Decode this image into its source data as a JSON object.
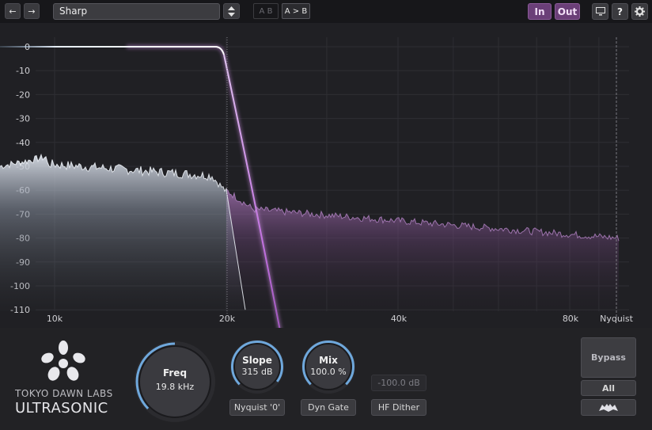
{
  "toolbar": {
    "back_glyph": "←",
    "forward_glyph": "→",
    "preset_name": "Sharp",
    "ab_label": "A B",
    "a_to_b_label": "A > B",
    "in_label": "In",
    "out_label": "Out",
    "help_label": "?",
    "icons": [
      "arrow-left-icon",
      "arrow-right-icon",
      "up-down-icon",
      "monitor-icon",
      "help-icon",
      "gear-icon"
    ]
  },
  "graph": {
    "y_ticks": [
      "0",
      "-10",
      "-20",
      "-30",
      "-40",
      "-50",
      "-60",
      "-70",
      "-80",
      "-90",
      "-100",
      "-110"
    ],
    "x_ticks": [
      "10k",
      "20k",
      "40k",
      "80k",
      "Nyquist"
    ],
    "colors": {
      "background": "#202024",
      "grid": "#2e2e33",
      "filter": "#c88adf",
      "input": "#cfd4dd",
      "output": "#9c6aa8"
    }
  },
  "controls": {
    "freq": {
      "label": "Freq",
      "value": "19.8 kHz"
    },
    "slope": {
      "label": "Slope",
      "value": "315 dB",
      "level": 0.97
    },
    "mix": {
      "label": "Mix",
      "value": "100.0 %",
      "level": 1.0
    },
    "nyquist_button": "Nyquist '0'",
    "dyn_gate_button": "Dyn Gate",
    "dither_level": "-100.0 dB",
    "hf_dither_button": "HF Dither",
    "bypass_button": "Bypass",
    "all_button": "All",
    "accent": "#6fa8dc"
  },
  "brand": {
    "company": "TOKYO DAWN LABS",
    "product": "ULTRASONIC"
  }
}
